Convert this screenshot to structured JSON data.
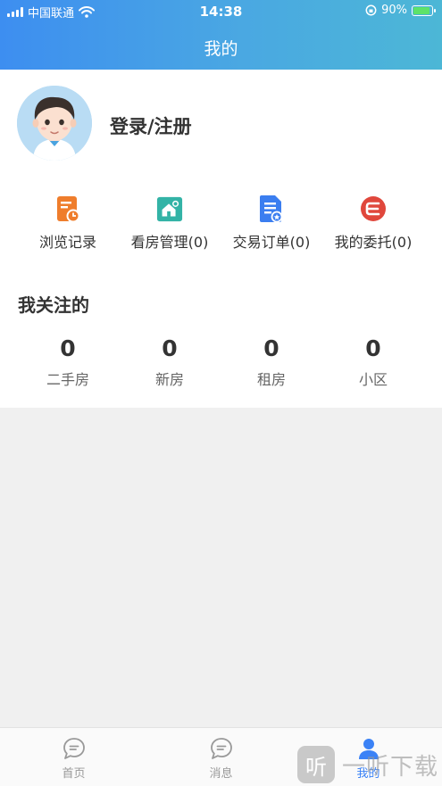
{
  "status_bar": {
    "carrier": "中国联通",
    "time": "14:38",
    "battery_percent": "90%",
    "battery_level": 0.9,
    "icons": [
      "signal-icon",
      "wifi-icon",
      "orientation-lock-icon",
      "battery-icon"
    ]
  },
  "header": {
    "title": "我的"
  },
  "profile": {
    "login_label": "登录/注册",
    "avatar_icon": "user-avatar"
  },
  "menu": {
    "items": [
      {
        "label": "浏览记录",
        "icon": "history-icon",
        "color": "#ef7d2c"
      },
      {
        "label": "看房管理(0)",
        "icon": "house-manage-icon",
        "color": "#33b3a6"
      },
      {
        "label": "交易订单(0)",
        "icon": "order-icon",
        "color": "#3b7ef0"
      },
      {
        "label": "我的委托(0)",
        "icon": "entrust-icon",
        "color": "#e0473c"
      }
    ]
  },
  "favorites": {
    "title": "我关注的",
    "stats": [
      {
        "value": "0",
        "label": "二手房"
      },
      {
        "value": "0",
        "label": "新房"
      },
      {
        "value": "0",
        "label": "租房"
      },
      {
        "value": "0",
        "label": "小区"
      }
    ]
  },
  "tabbar": {
    "tabs": [
      {
        "label": "首页",
        "icon": "chat-bubble-icon",
        "active": false
      },
      {
        "label": "消息",
        "icon": "chat-bubble-icon",
        "active": false
      },
      {
        "label": "我的",
        "icon": "person-icon",
        "active": true
      }
    ],
    "active_color": "#3b82f6",
    "inactive_color": "#999999"
  },
  "watermark": {
    "glyph": "听",
    "text": "一听下载"
  }
}
